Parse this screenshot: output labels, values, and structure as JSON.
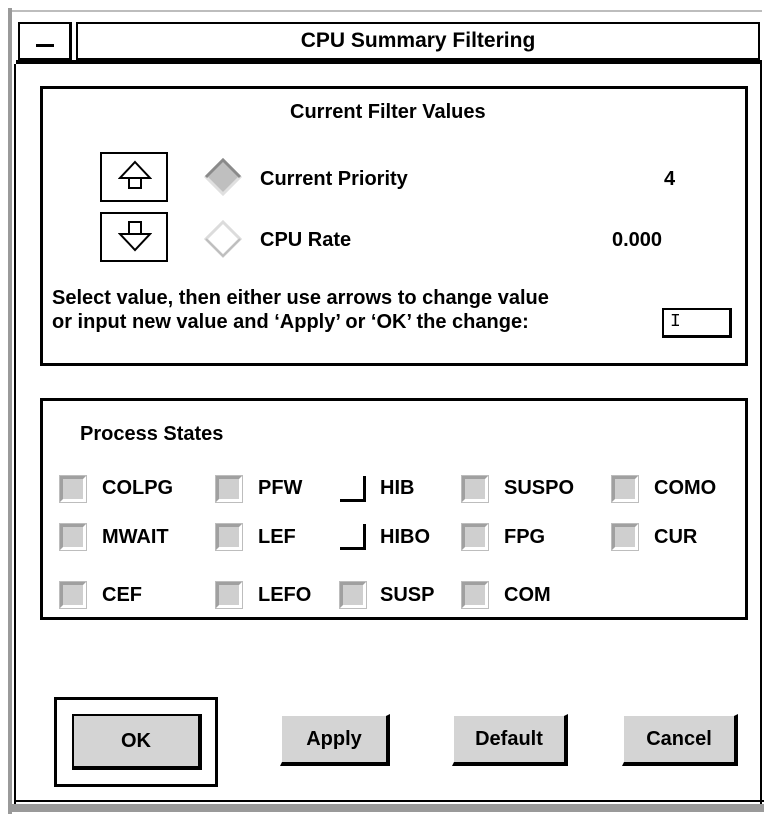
{
  "window": {
    "title": "CPU Summary Filtering"
  },
  "filter": {
    "heading": "Current Filter Values",
    "items": [
      {
        "label": "Current Priority",
        "value": "4",
        "selected": true
      },
      {
        "label": "CPU Rate",
        "value": "0.000",
        "selected": false
      }
    ],
    "instructions_line1": "Select value, then either use arrows to change value",
    "instructions_line2": "or input new value and ‘Apply’ or ‘OK’ the change:",
    "input_value": "I"
  },
  "states": {
    "heading": "Process States",
    "items": [
      {
        "label": "COLPG",
        "checked": true
      },
      {
        "label": "PFW",
        "checked": true
      },
      {
        "label": "HIB",
        "checked": false
      },
      {
        "label": "SUSPO",
        "checked": true
      },
      {
        "label": "COMO",
        "checked": true
      },
      {
        "label": "MWAIT",
        "checked": true
      },
      {
        "label": "LEF",
        "checked": true
      },
      {
        "label": "HIBO",
        "checked": false
      },
      {
        "label": "FPG",
        "checked": true
      },
      {
        "label": "CUR",
        "checked": true
      },
      {
        "label": "CEF",
        "checked": true
      },
      {
        "label": "LEFO",
        "checked": true
      },
      {
        "label": "SUSP",
        "checked": true
      },
      {
        "label": "COM",
        "checked": true
      }
    ]
  },
  "buttons": {
    "ok": "OK",
    "apply": "Apply",
    "default": "Default",
    "cancel": "Cancel"
  },
  "colors": {
    "checked_fill": "#cfcfcf",
    "button_face": "#d4d4d4",
    "selected_diamond": "#bfbfbf"
  }
}
